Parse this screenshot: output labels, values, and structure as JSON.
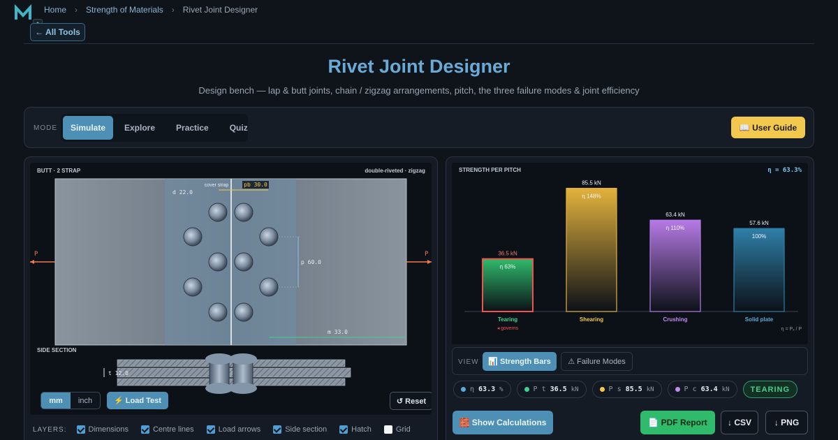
{
  "breadcrumb": {
    "home": "Home",
    "section": "Strength of Materials",
    "current": "Rivet Joint Designer"
  },
  "nav": {
    "all_tools": "← All Tools"
  },
  "header": {
    "title": "Rivet Joint Designer",
    "subtitle": "Design bench — lap & butt joints, chain / zigzag arrangements, pitch, the three failure modes & joint efficiency"
  },
  "mode": {
    "label": "MODE",
    "tabs": [
      "Simulate",
      "Explore",
      "Practice",
      "Quiz"
    ],
    "active": "Simulate",
    "guide_button": "📖 User Guide"
  },
  "joint_view": {
    "joint_label": "BUTT · 2 STRAP",
    "arrangement_label": "double-riveted · zigzag",
    "cover_strap_label": "cover strap",
    "diameter_label": "d 22.0",
    "pitch_back_label": "pb 30.0",
    "pitch_label": "p 60.0",
    "margin_label": "m 33.0",
    "load_left": "P",
    "load_right": "P",
    "side_section_label": "SIDE SECTION",
    "thickness_label": "t 12.0"
  },
  "controls": {
    "units": [
      "mm",
      "inch"
    ],
    "active_unit": "mm",
    "load_test": "⚡ Load Test",
    "reset": "↺ Reset"
  },
  "layers": {
    "label": "LAYERS:",
    "items": [
      {
        "label": "Dimensions",
        "checked": true
      },
      {
        "label": "Centre lines",
        "checked": true
      },
      {
        "label": "Load arrows",
        "checked": true
      },
      {
        "label": "Side section",
        "checked": true
      },
      {
        "label": "Hatch",
        "checked": true
      },
      {
        "label": "Grid",
        "checked": false
      }
    ]
  },
  "chart_data": {
    "type": "bar",
    "title": "STRENGTH PER PITCH",
    "efficiency_label": "η = 63.3%",
    "categories": [
      "Tearing",
      "Shearing",
      "Crushing",
      "Solid plate"
    ],
    "values": [
      36.5,
      85.5,
      63.4,
      57.6
    ],
    "value_labels": [
      "36.5 kN",
      "85.5 kN",
      "63.4 kN",
      "57.6 kN"
    ],
    "percent_labels": [
      "η 63%",
      "η 148%",
      "η 110%",
      "100%"
    ],
    "colors": [
      "#2fbb6b",
      "#e3b23c",
      "#b67ae6",
      "#2f7fa8"
    ],
    "label_colors": [
      "#43d18d",
      "#f2c94c",
      "#c18cf0",
      "#5ba9d4"
    ],
    "governs_label": "◂ governs",
    "footnote": "η = Pₓ / P",
    "ylim": [
      0,
      95
    ]
  },
  "view": {
    "label": "VIEW",
    "tabs": [
      "📊 Strength Bars",
      "⚠ Failure Modes"
    ],
    "active": "📊 Strength Bars"
  },
  "readouts": [
    {
      "symbol": "η",
      "value": "63.3",
      "unit": "%",
      "color": "#5ba9d4"
    },
    {
      "symbol": "P t",
      "value": "36.5",
      "unit": "kN",
      "color": "#43d18d"
    },
    {
      "symbol": "P s",
      "value": "85.5",
      "unit": "kN",
      "color": "#f2c94c"
    },
    {
      "symbol": "P c",
      "value": "63.4",
      "unit": "kN",
      "color": "#c18cf0"
    }
  ],
  "status": "TEARING",
  "actions": {
    "show_calculations": "🧱 Show Calculations",
    "pdf_report": "📄 PDF Report",
    "csv": "↓ CSV",
    "png": "↓ PNG"
  }
}
